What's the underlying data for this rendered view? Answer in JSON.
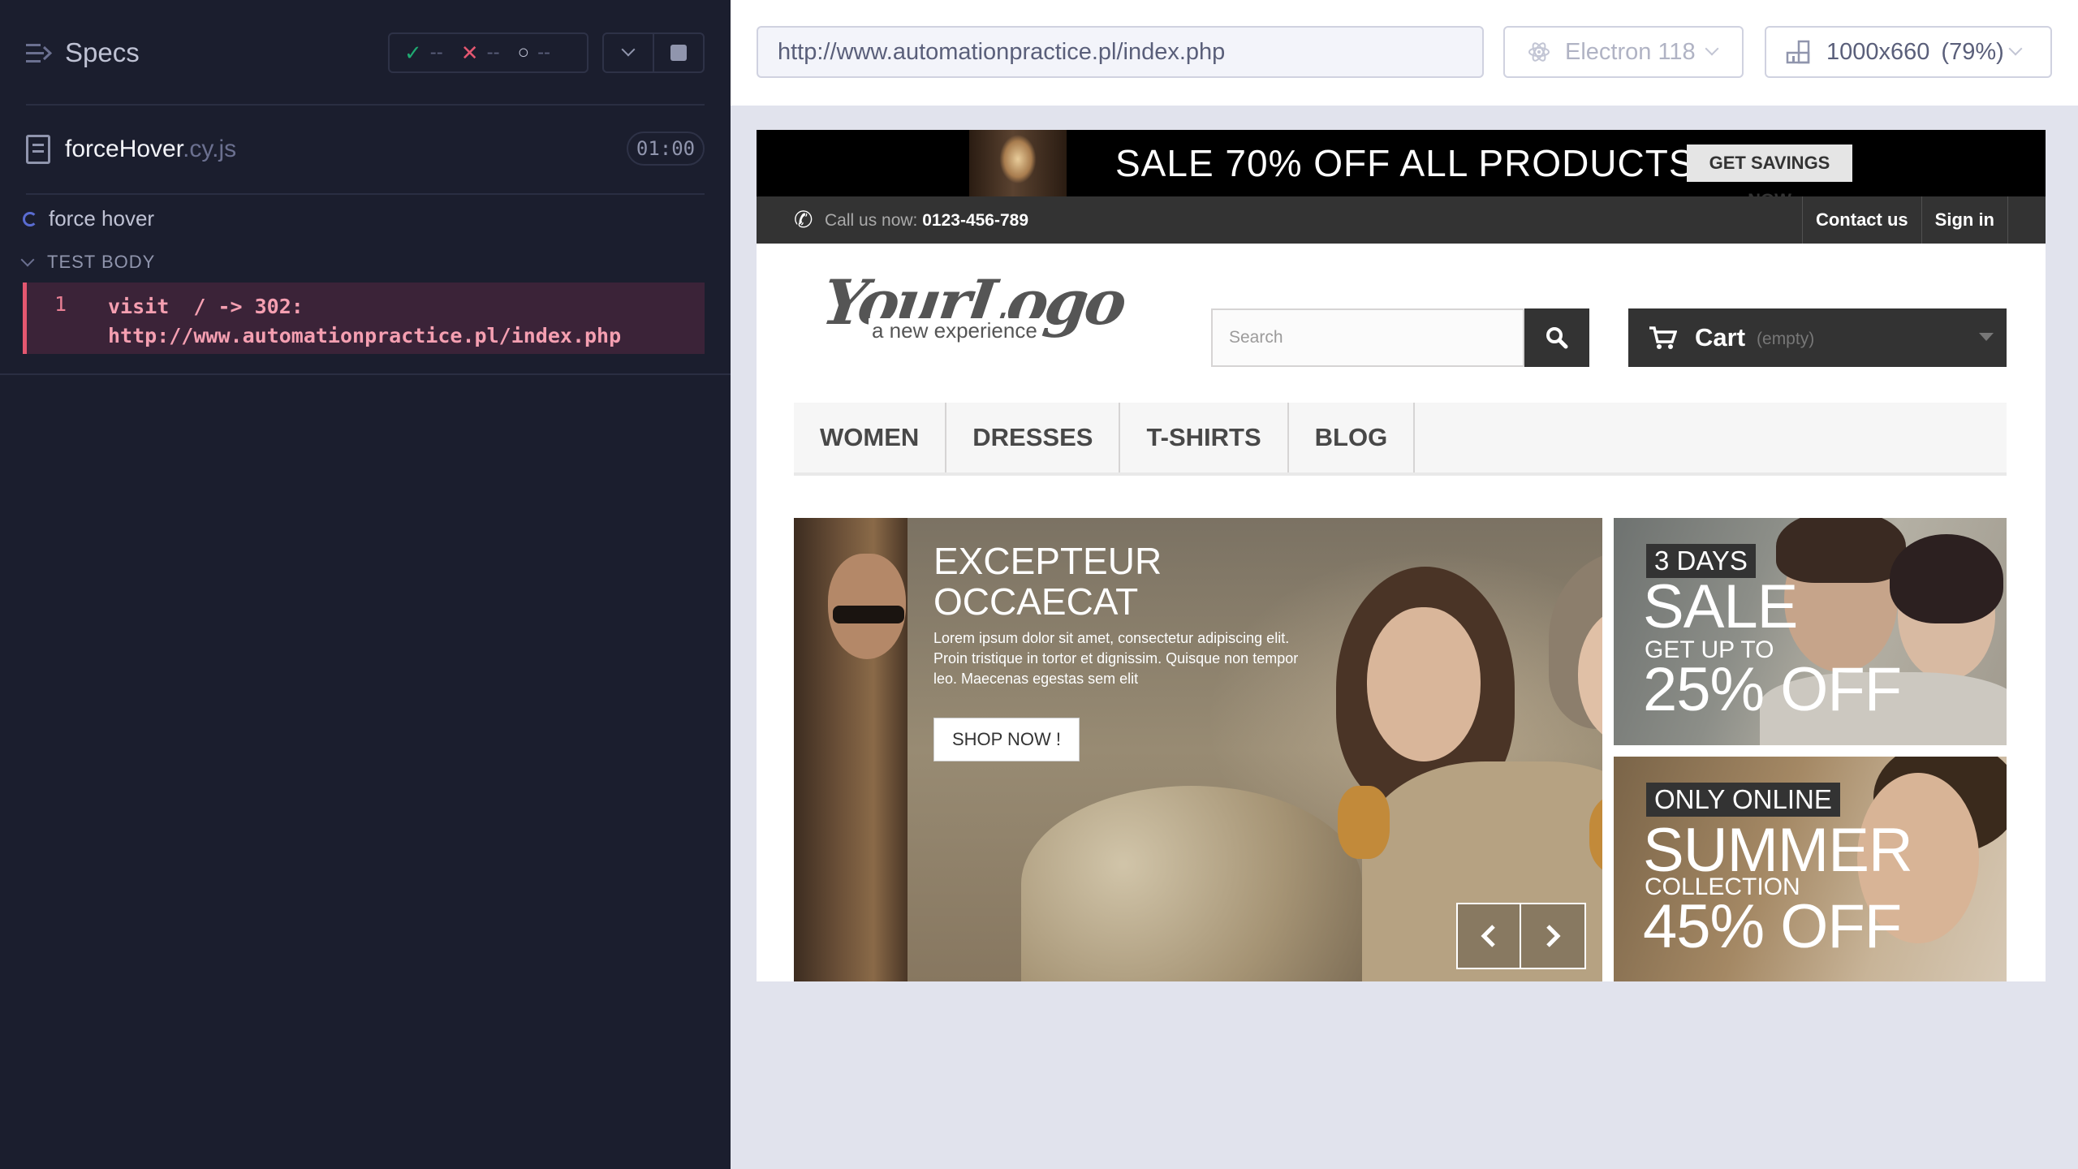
{
  "reporter": {
    "title": "Specs",
    "stats": {
      "passed": "--",
      "failed": "--",
      "pending": "--"
    },
    "spec": {
      "name": "forceHover",
      "ext": ".cy.js",
      "time": "01:00"
    },
    "test": {
      "title": "force hover",
      "body_label": "TEST BODY"
    },
    "command": {
      "number": "1",
      "line1": "visit  / -> 302:",
      "line2": "http://www.automationpractice.pl/index.php"
    }
  },
  "aut_header": {
    "url": "http://www.automationpractice.pl/index.php",
    "browser": "Electron 118",
    "viewport": "1000x660",
    "zoom": "(79%)"
  },
  "site": {
    "promo": {
      "text": "SALE 70% OFF ALL PRODUCTS",
      "button": "GET SAVINGS NOW"
    },
    "nav": {
      "call_label": "Call us now:",
      "phone": "0123-456-789",
      "contact": "Contact us",
      "sign_in": "Sign in"
    },
    "logo": {
      "main": "YourLogo",
      "sub": "a new experience"
    },
    "search": {
      "placeholder": "Search"
    },
    "cart": {
      "title": "Cart",
      "status": "(empty)"
    },
    "menu": [
      "WOMEN",
      "DRESSES",
      "T-SHIRTS",
      "BLOG"
    ],
    "slide": {
      "title_line1": "EXCEPTEUR",
      "title_line2": "OCCAECAT",
      "text": "Lorem ipsum dolor sit amet, consectetur adipiscing elit. Proin tristique in tortor et dignissim. Quisque non tempor leo. Maecenas egestas sem elit",
      "button": "SHOP NOW !"
    },
    "banner1": {
      "tag": "3 DAYS",
      "big": "SALE",
      "small": "GET UP TO",
      "pct": "25% OFF"
    },
    "banner2": {
      "tag": "ONLY ONLINE",
      "big": "SUMMER",
      "small": "COLLECTION",
      "pct": "45% OFF"
    }
  },
  "colors": {
    "reporter_bg": "#1b1e2e",
    "command_bg": "#3b2338",
    "command_border": "#e45770",
    "pass": "#1fa971",
    "fail": "#e45770"
  }
}
